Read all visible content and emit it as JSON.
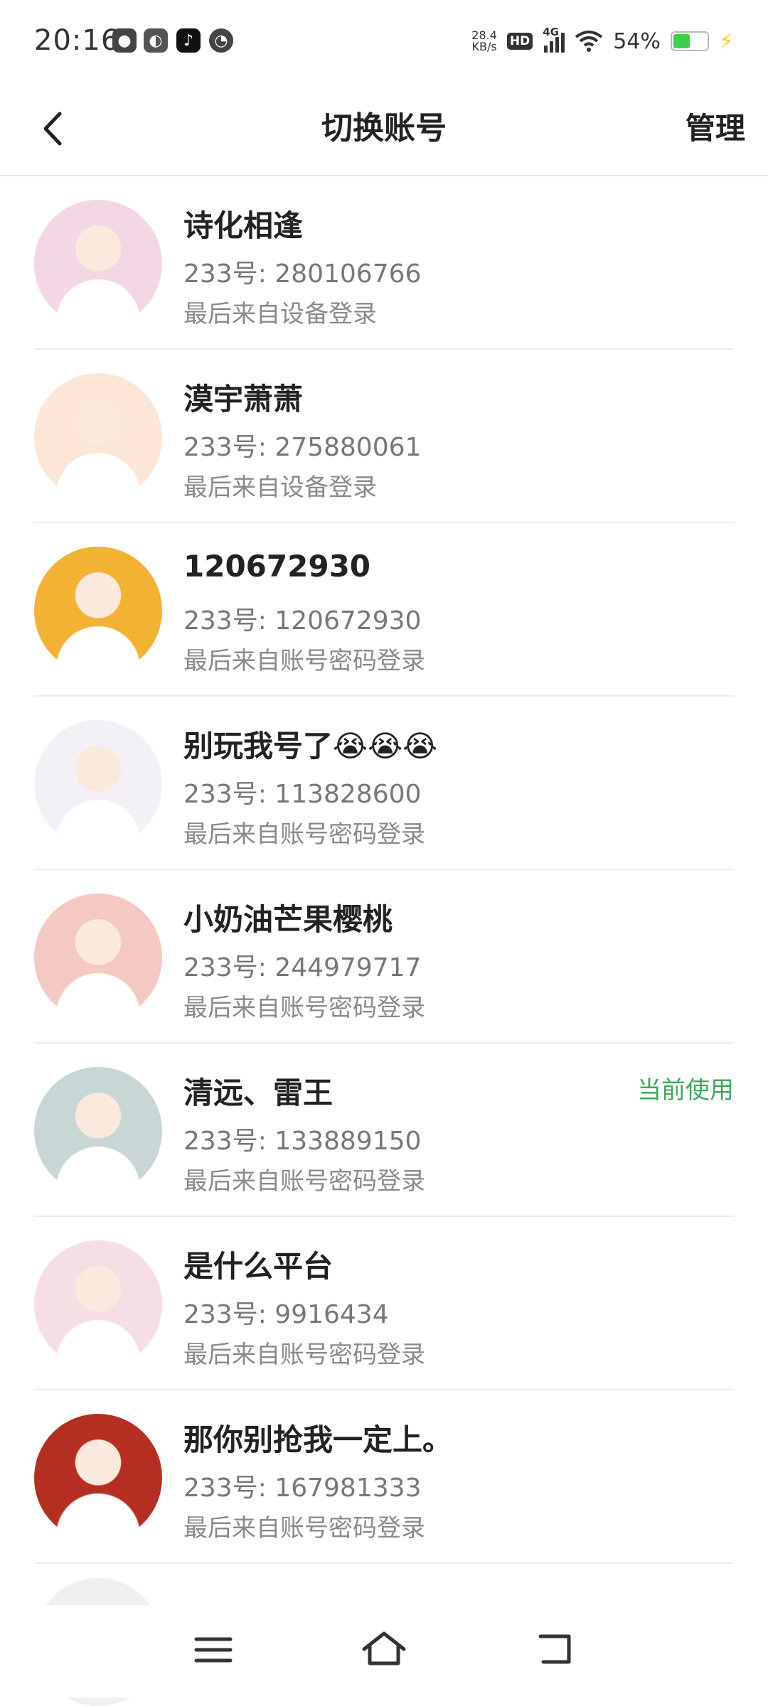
{
  "status": {
    "time": "20:16",
    "net_speed_value": "28.4",
    "net_speed_unit": "KB/s",
    "hd": "HD",
    "network": "4G",
    "battery": "54%",
    "battery_level": 0.54,
    "app_icons": [
      "qq-icon",
      "wechat-icon",
      "tiktok-icon",
      "compass-app-icon"
    ]
  },
  "header": {
    "title": "切换账号",
    "manage": "管理"
  },
  "accounts": [
    {
      "name": "诗化相逢",
      "uid": "233号: 280106766",
      "note": "最后来自设备登录",
      "current": ""
    },
    {
      "name": "漠宇萧萧",
      "uid": "233号: 275880061",
      "note": "最后来自设备登录",
      "current": ""
    },
    {
      "name": "120672930",
      "uid": "233号: 120672930",
      "note": "最后来自账号密码登录",
      "current": ""
    },
    {
      "name": "别玩我号了😭😭😭",
      "uid": "233号: 113828600",
      "note": "最后来自账号密码登录",
      "current": ""
    },
    {
      "name": "小奶油芒果樱桃",
      "uid": "233号: 244979717",
      "note": "最后来自账号密码登录",
      "current": ""
    },
    {
      "name": "清远、雷王",
      "uid": "233号: 133889150",
      "note": "最后来自账号密码登录",
      "current": "当前使用"
    },
    {
      "name": "是什么平台",
      "uid": "233号: 9916434",
      "note": "最后来自账号密码登录",
      "current": ""
    },
    {
      "name": "那你别抢我一定上。",
      "uid": "233号: 167981333",
      "note": "最后来自账号密码登录",
      "current": ""
    }
  ],
  "colors": {
    "accent_green": "#3ea85a",
    "avatar_bg": [
      "#f4d7e4",
      "#fbe6d8",
      "#f2b233",
      "#f3f0f6",
      "#f4c9c3",
      "#c8d6d5",
      "#f6dfe4",
      "#b52e22"
    ]
  }
}
